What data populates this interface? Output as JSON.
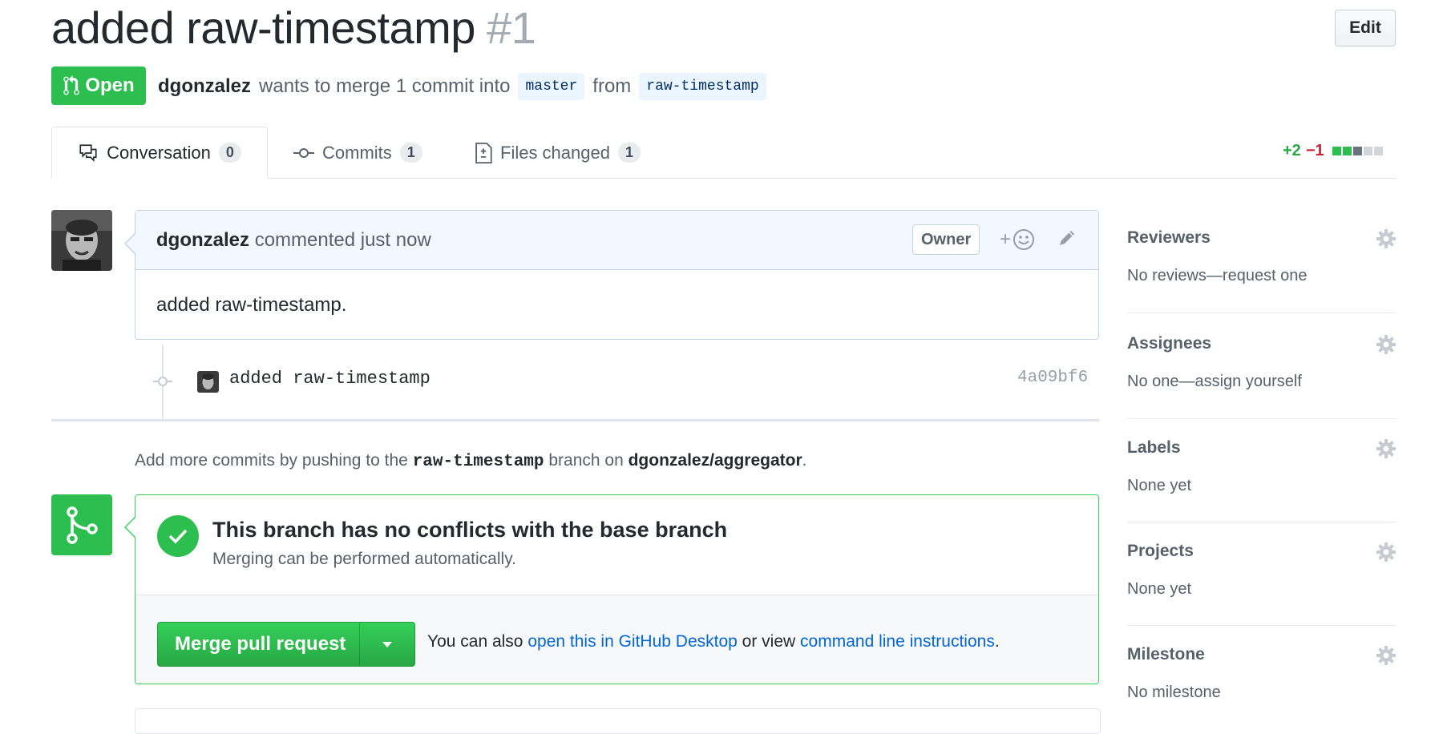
{
  "header": {
    "title": "added raw-timestamp",
    "number": "#1",
    "edit_label": "Edit",
    "state": "Open",
    "author": "dgonzalez",
    "meta_text": "wants to merge 1 commit into",
    "base_branch": "master",
    "from_text": "from",
    "head_branch": "raw-timestamp"
  },
  "tabs": [
    {
      "label": "Conversation",
      "count": "0"
    },
    {
      "label": "Commits",
      "count": "1"
    },
    {
      "label": "Files changed",
      "count": "1"
    }
  ],
  "diffstat": {
    "additions": "+2",
    "deletions": "−1"
  },
  "comment": {
    "author": "dgonzalez",
    "action": "commented just now",
    "role": "Owner",
    "reaction_plus": "+",
    "body": "added raw-timestamp."
  },
  "commit": {
    "message": "added raw-timestamp",
    "sha": "4a09bf6"
  },
  "push_hint": {
    "pre": "Add more commits by pushing to the",
    "branch": "raw-timestamp",
    "mid": "branch on",
    "repo": "dgonzalez/aggregator",
    "end": "."
  },
  "merge": {
    "title": "This branch has no conflicts with the base branch",
    "subtitle": "Merging can be performed automatically.",
    "button": "Merge pull request",
    "alt_pre": "You can also",
    "desktop_link": "open this in GitHub Desktop",
    "alt_mid": "or view",
    "cli_link": "command line instructions",
    "alt_end": "."
  },
  "sidebar": [
    {
      "title": "Reviewers",
      "value": "No reviews—request one"
    },
    {
      "title": "Assignees",
      "value": "No one—assign yourself"
    },
    {
      "title": "Labels",
      "value": "None yet"
    },
    {
      "title": "Projects",
      "value": "None yet"
    },
    {
      "title": "Milestone",
      "value": "No milestone"
    }
  ],
  "colors": {
    "open_green": "#2cbe4e",
    "link_blue": "#0366d6",
    "muted": "#586069",
    "text": "#24292e"
  },
  "icons": [
    "git-pull-request-icon",
    "comment-discussion-icon",
    "git-commit-icon",
    "file-diff-icon",
    "smiley-icon",
    "pencil-icon",
    "git-merge-icon",
    "check-icon",
    "triangle-down-icon",
    "gear-icon"
  ]
}
